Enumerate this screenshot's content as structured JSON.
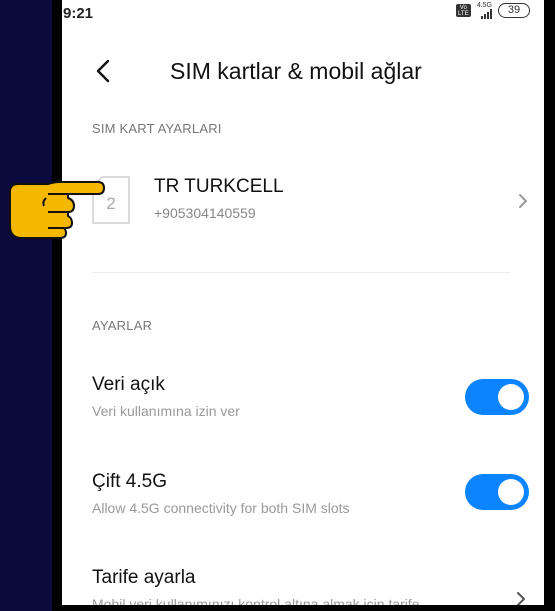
{
  "status_bar": {
    "time": "9:21",
    "volte_label": "Vo LTE",
    "network_type": "4.5G",
    "battery": "39"
  },
  "header": {
    "title": "SIM kartlar & mobil ağlar"
  },
  "sim_section": {
    "label": "SIM KART AYARLARI",
    "sim": {
      "slot": "2",
      "carrier": "TR TURKCELL",
      "number": "+905304140559"
    }
  },
  "settings_section": {
    "label": "AYARLAR",
    "items": [
      {
        "title": "Veri açık",
        "subtitle": "Veri kullanımına izin ver",
        "enabled": true
      },
      {
        "title": "Çift 4.5G",
        "subtitle": "Allow 4.5G connectivity for both SIM slots",
        "enabled": true
      },
      {
        "title": "Tarife ayarla",
        "subtitle": "Mobil veri kullanımınızı kontrol altına almak için tarife"
      }
    ]
  },
  "colors": {
    "accent": "#0c84ff",
    "left_band": "#0a0a3c",
    "pointer": "#f5b800"
  },
  "annotation": {
    "pointer_icon": "pointing-hand"
  }
}
